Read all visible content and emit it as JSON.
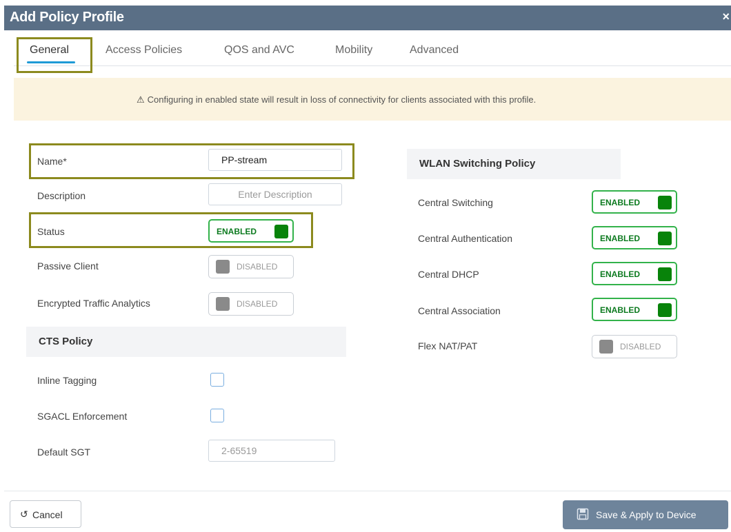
{
  "dialog": {
    "title": "Add Policy Profile",
    "close_glyph": "×"
  },
  "tabs": [
    {
      "label": "General",
      "active": true
    },
    {
      "label": "Access Policies"
    },
    {
      "label": "QOS and AVC"
    },
    {
      "label": "Mobility"
    },
    {
      "label": "Advanced"
    }
  ],
  "banner": {
    "icon": "warning-icon",
    "message": "Configuring in enabled state will result in loss of connectivity for clients associated with this profile."
  },
  "general": {
    "name_label": "Name*",
    "name_value": "PP-stream",
    "description_label": "Description",
    "description_placeholder": "Enter Description",
    "status_label": "Status",
    "status_state": "ENABLED",
    "passive_client_label": "Passive Client",
    "passive_client_state": "DISABLED",
    "eta_label": "Encrypted Traffic Analytics",
    "eta_state": "DISABLED"
  },
  "cts": {
    "heading": "CTS Policy",
    "inline_tagging_label": "Inline Tagging",
    "sgacl_label": "SGACL Enforcement",
    "default_sgt_label": "Default SGT",
    "default_sgt_placeholder": "2-65519"
  },
  "wlan": {
    "heading": "WLAN Switching Policy",
    "items": [
      {
        "label": "Central Switching",
        "state": "ENABLED"
      },
      {
        "label": "Central Authentication",
        "state": "ENABLED"
      },
      {
        "label": "Central DHCP",
        "state": "ENABLED"
      },
      {
        "label": "Central Association",
        "state": "ENABLED"
      },
      {
        "label": "Flex NAT/PAT",
        "state": "DISABLED"
      }
    ]
  },
  "footer": {
    "cancel_label": "Cancel",
    "cancel_icon": "undo-icon",
    "save_label": "Save & Apply to Device",
    "save_icon": "save-icon"
  },
  "colors": {
    "titlebar": "#5a6f86",
    "active_tab_underline": "#1e9ad6",
    "highlight_outline": "#8c8a1e",
    "banner_bg": "#fbf3df",
    "enabled_green": "#08830a",
    "save_button": "#6e849b"
  }
}
